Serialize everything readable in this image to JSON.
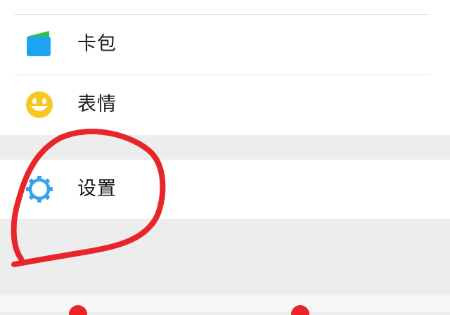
{
  "menu": {
    "items": [
      {
        "label": "卡包",
        "icon": "card-wallet-icon"
      },
      {
        "label": "表情",
        "icon": "smiley-icon"
      },
      {
        "label": "设置",
        "icon": "gear-icon"
      }
    ]
  },
  "colors": {
    "background": "#ededed",
    "card": "#ffffff",
    "wallet_blue": "#1ea4ef",
    "wallet_green": "#2fbf4a",
    "smiley_yellow": "#f7c820",
    "gear_blue": "#3aa2e8",
    "annotation_red": "#e8262a"
  }
}
